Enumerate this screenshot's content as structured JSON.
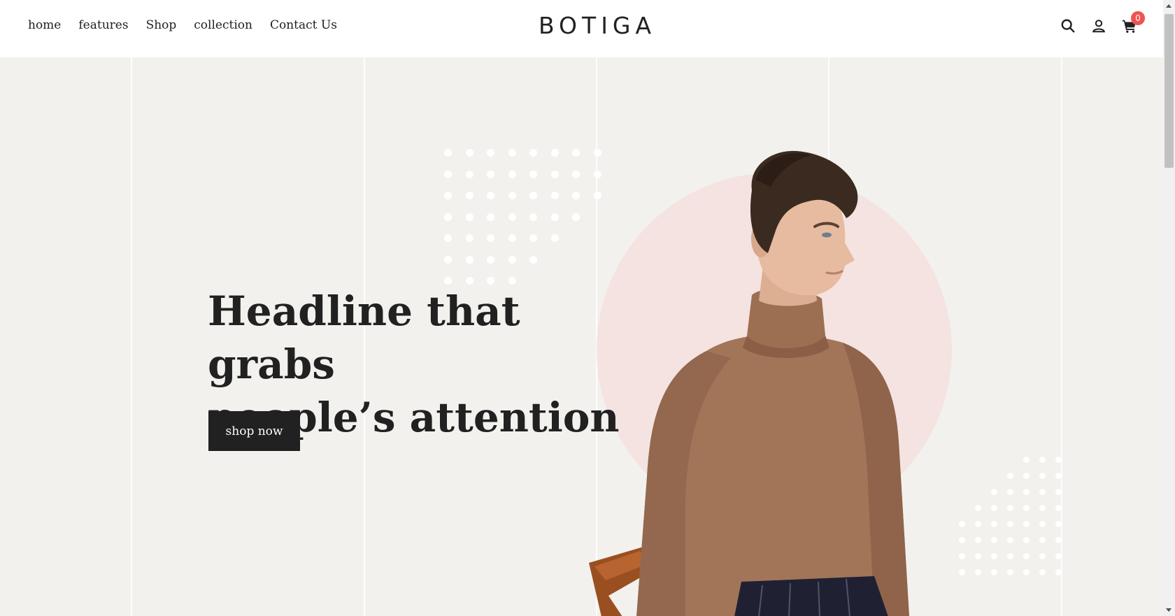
{
  "nav": {
    "items": [
      {
        "label": "home"
      },
      {
        "label": "features"
      },
      {
        "label": "Shop"
      },
      {
        "label": "collection"
      },
      {
        "label": "Contact Us"
      }
    ]
  },
  "brand": {
    "logo": "BOTIGA"
  },
  "header_icons": {
    "search": "search-icon",
    "account": "user-icon",
    "cart": "cart-icon",
    "cart_count": "0"
  },
  "hero": {
    "headline_line1": "Headline that grabs",
    "headline_line2": "people’s attention",
    "cta_label": "shop now"
  },
  "colors": {
    "hero_bg": "#f2f1ee",
    "accent_circle": "#f4e3e1",
    "button_bg": "#212121",
    "badge": "#ef5350"
  }
}
